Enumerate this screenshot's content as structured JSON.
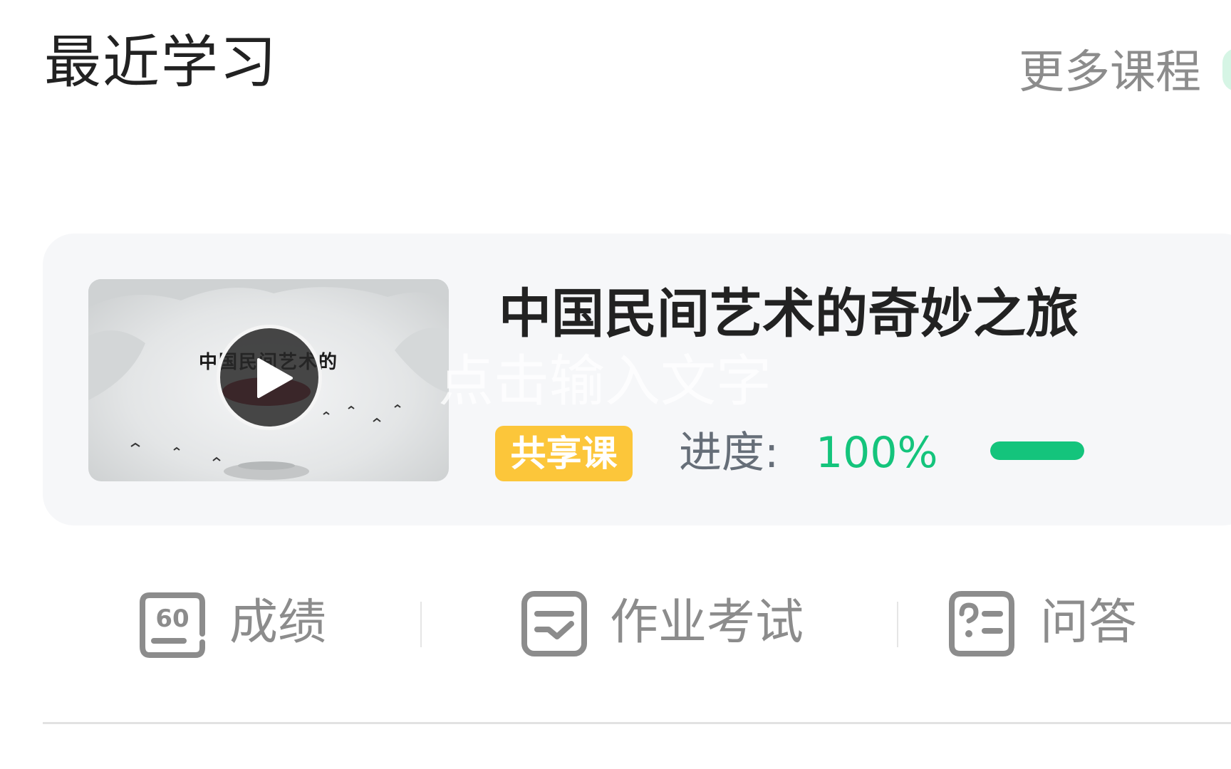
{
  "header": {
    "title": "最近学习",
    "more_label": "更多课程"
  },
  "course": {
    "thumbnail_title": "中国民间艺术的",
    "thumbnail_icon": "play-icon",
    "title": "中国民间艺术的奇妙之旅",
    "overlay_text": "点击输入文字",
    "tag": "共享课",
    "progress_label": "进度:",
    "progress_value": "100%",
    "progress_fraction": 1.0
  },
  "actions": [
    {
      "label": "成绩",
      "icon": "score-60-icon",
      "icon_text": "60"
    },
    {
      "label": "作业考试",
      "icon": "homework-icon"
    },
    {
      "label": "问答",
      "icon": "qa-icon"
    }
  ],
  "colors": {
    "accent_green": "#14c47c",
    "tag_yellow": "#fcc63a",
    "title_text": "#222222",
    "muted_text": "#8c8c8c",
    "card_bg": "#f6f7f9"
  }
}
